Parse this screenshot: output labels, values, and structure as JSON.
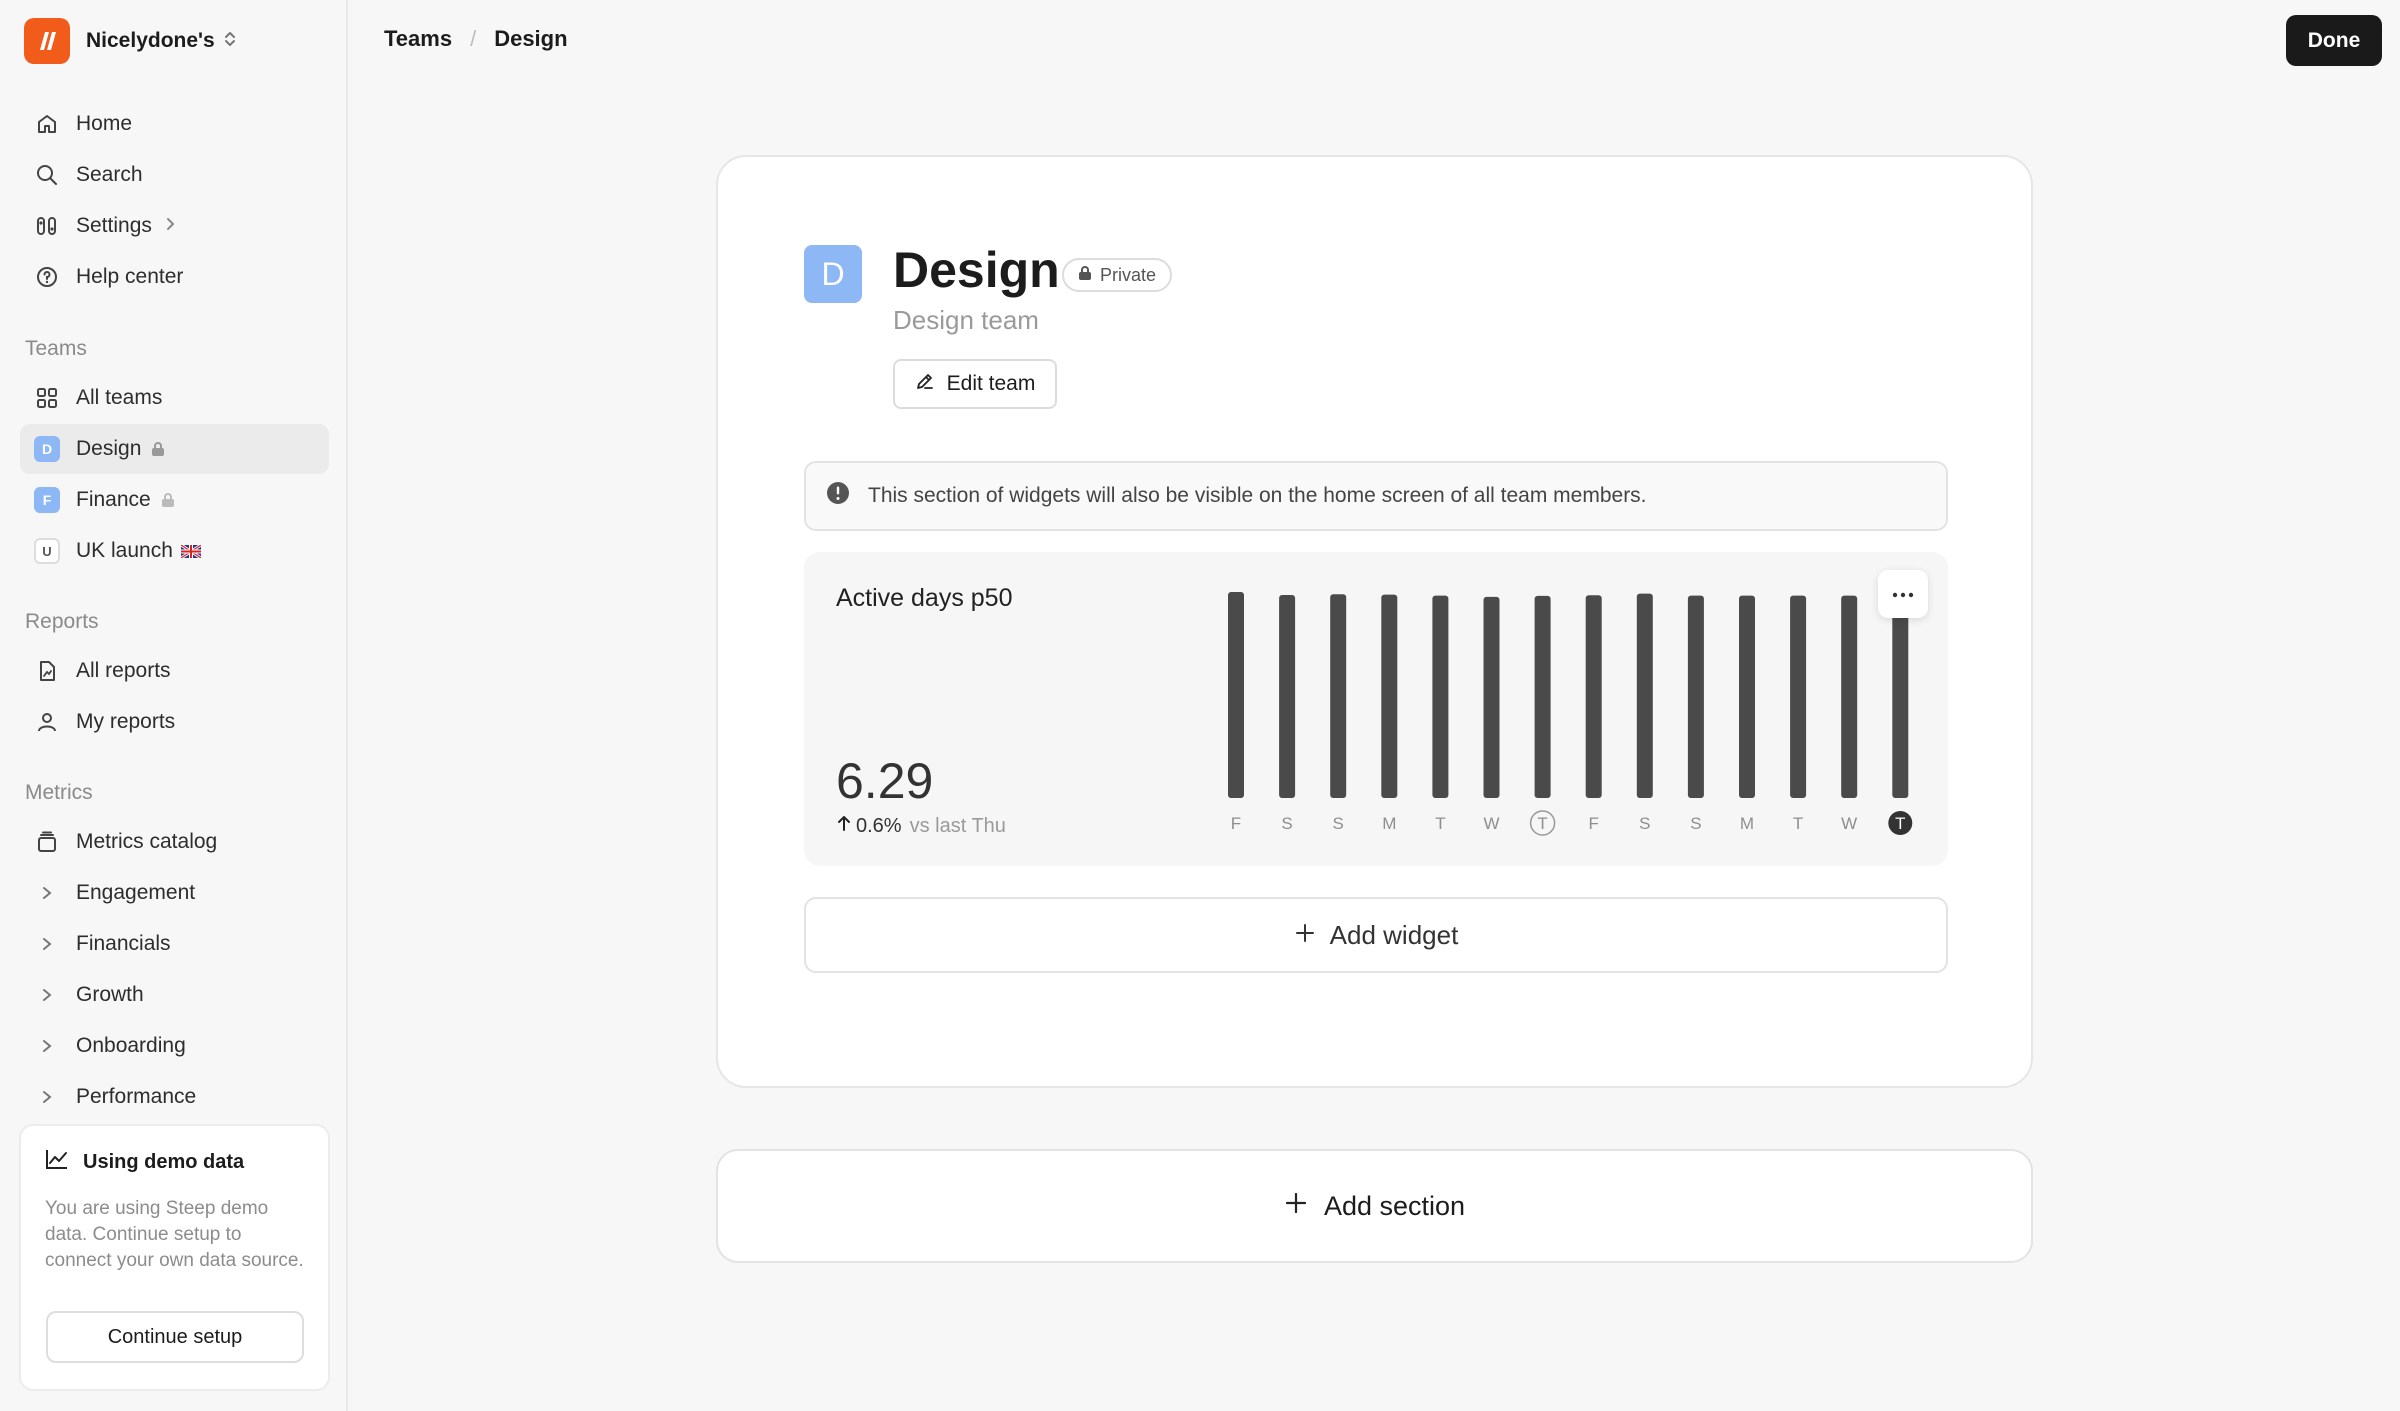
{
  "workspace": {
    "name": "Nicelydone's",
    "logo_color": "#f25c1b"
  },
  "nav": {
    "home": "Home",
    "search": "Search",
    "settings": "Settings",
    "help": "Help center"
  },
  "teams_section": {
    "label": "Teams",
    "items": [
      {
        "label": "All teams"
      },
      {
        "label": "Design",
        "badge": "D",
        "badge_color": "#8eb7f5",
        "locked": true
      },
      {
        "label": "Finance",
        "badge": "F",
        "badge_color": "#8eb7f5",
        "locked": true
      },
      {
        "label": "UK launch",
        "badge": "U",
        "flag": "uk-flag-icon"
      }
    ]
  },
  "reports_section": {
    "label": "Reports",
    "items": [
      {
        "label": "All reports"
      },
      {
        "label": "My reports"
      }
    ]
  },
  "metrics_section": {
    "label": "Metrics",
    "items": [
      {
        "label": "Metrics catalog"
      },
      {
        "label": "Engagement"
      },
      {
        "label": "Financials"
      },
      {
        "label": "Growth"
      },
      {
        "label": "Onboarding"
      },
      {
        "label": "Performance"
      }
    ]
  },
  "demo": {
    "title": "Using demo data",
    "text": "You are using Steep demo data. Continue setup to connect your own data source.",
    "button": "Continue setup"
  },
  "breadcrumb": {
    "parent": "Teams",
    "separator": "/",
    "current": "Design"
  },
  "header": {
    "done_label": "Done"
  },
  "team": {
    "avatar_letter": "D",
    "name": "Design",
    "privacy": "Private",
    "description": "Design team",
    "edit_label": "Edit team"
  },
  "notice": {
    "text": "This section of widgets will also be visible on the home screen of all team members."
  },
  "widget": {
    "title": "Active days p50",
    "value": "6.29",
    "delta": "0.6%",
    "delta_suffix": "vs last Thu"
  },
  "chart_data": {
    "type": "bar",
    "categories": [
      "F",
      "S",
      "S",
      "M",
      "T",
      "W",
      "T",
      "F",
      "S",
      "S",
      "M",
      "T",
      "W",
      "T"
    ],
    "values": [
      6.29,
      6.2,
      6.22,
      6.21,
      6.18,
      6.14,
      6.17,
      6.19,
      6.24,
      6.18,
      6.18,
      6.18,
      6.18,
      6.29
    ],
    "highlight": {
      "outlined_index": 6,
      "filled_index": 13
    },
    "bar_color": "#4a4a4a"
  },
  "add_widget_label": "Add widget",
  "add_section_label": "Add section"
}
